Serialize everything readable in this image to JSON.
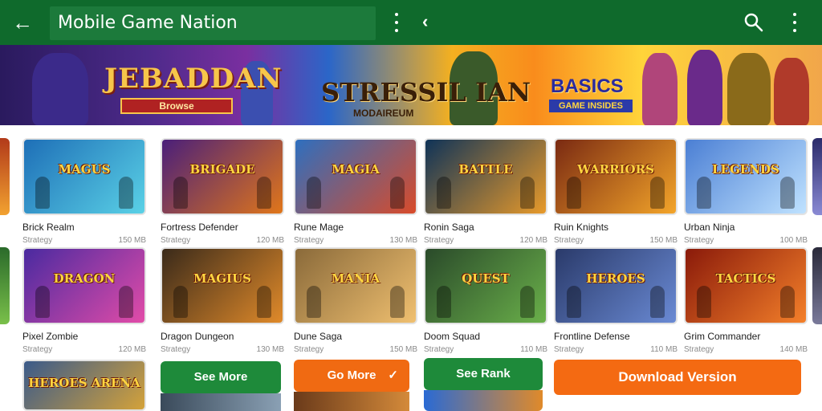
{
  "header": {
    "title": "Mobile Game Nation",
    "back_icon": "arrow-back-icon",
    "menu_icon": "more-vert-icon",
    "nav_icon": "chevron-left-icon",
    "search_icon": "search-icon",
    "colors": {
      "bar": "#0f6a2c",
      "title_box": "#1c7a3b"
    }
  },
  "banner": {
    "left_title": "JEBADDAN",
    "left_button": "Browse",
    "mid_title": "STRESSIL IAN",
    "mid_subtitle": "MODAIREUM",
    "right_title": "BASICS",
    "right_subtitle": "GAME INSIDES"
  },
  "rows": [
    [
      {
        "name": "Brick Realm",
        "meta_left": "Strategy",
        "meta_right": "150 MB",
        "thumb": "lvl-1",
        "logo": "MAGUS"
      },
      {
        "name": "Fortress Defender",
        "meta_left": "Strategy",
        "meta_right": "120 MB",
        "thumb": "lvl-2",
        "logo": "BRIGADE"
      },
      {
        "name": "Rune Mage",
        "meta_left": "Strategy",
        "meta_right": "130 MB",
        "thumb": "lvl-3",
        "logo": "MAGIA"
      },
      {
        "name": "Ronin Saga",
        "meta_left": "Strategy",
        "meta_right": "120 MB",
        "thumb": "lvl-4",
        "logo": "BATTLE"
      },
      {
        "name": "Ruin Knights",
        "meta_left": "Strategy",
        "meta_right": "150 MB",
        "thumb": "lvl-5",
        "logo": "WARRIORS"
      },
      {
        "name": "Urban Ninja",
        "meta_left": "Strategy",
        "meta_right": "100 MB",
        "thumb": "lvl-6",
        "logo": "LEGENDS"
      }
    ],
    [
      {
        "name": "Pixel Zombie",
        "meta_left": "Strategy",
        "meta_right": "120 MB",
        "thumb": "lvl-7",
        "logo": "DRAGON"
      },
      {
        "name": "Dragon Dungeon",
        "meta_left": "Strategy",
        "meta_right": "130 MB",
        "thumb": "lvl-8",
        "logo": "MAGIUS"
      },
      {
        "name": "Dune Saga",
        "meta_left": "Strategy",
        "meta_right": "150 MB",
        "thumb": "lvl-9",
        "logo": "MANIA"
      },
      {
        "name": "Doom Squad",
        "meta_left": "Strategy",
        "meta_right": "110 MB",
        "thumb": "lvl-10",
        "logo": "QUEST"
      },
      {
        "name": "Frontline Defense",
        "meta_left": "Strategy",
        "meta_right": "110 MB",
        "thumb": "lvl-11",
        "logo": "HEROES"
      },
      {
        "name": "Grim Commander",
        "meta_left": "Strategy",
        "meta_right": "140 MB",
        "thumb": "lvl-12",
        "logo": "TACTICS"
      }
    ]
  ],
  "third_row": {
    "thumb_logo": "HEROES ARENA",
    "btn_green_1": "See More",
    "btn_orange": "Go More",
    "btn_green_2": "See Rank",
    "btn_wide": "Download Version"
  },
  "thumb_palettes": {
    "lvl-1": [
      "#1e6fb7",
      "#5ad1e6"
    ],
    "lvl-2": [
      "#4a1f7a",
      "#e0761a"
    ],
    "lvl-3": [
      "#2e6fbf",
      "#d94b2a"
    ],
    "lvl-4": [
      "#0f3358",
      "#e89a2a"
    ],
    "lvl-5": [
      "#7a2a12",
      "#f3a52a"
    ],
    "lvl-6": [
      "#4b7fd4",
      "#bfe2ff"
    ],
    "lvl-7": [
      "#4a2aa0",
      "#e24ca8"
    ],
    "lvl-8": [
      "#3a2a1a",
      "#e08a2a"
    ],
    "lvl-9": [
      "#8a6a3a",
      "#f0c070"
    ],
    "lvl-10": [
      "#2a4a2a",
      "#6ab04a"
    ],
    "lvl-11": [
      "#2a3a6a",
      "#6a8ad4"
    ],
    "lvl-12": [
      "#8a1a0a",
      "#f4802a"
    ]
  }
}
